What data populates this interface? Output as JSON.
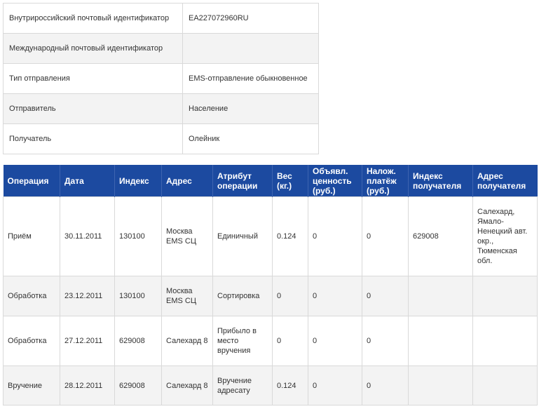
{
  "info": {
    "rows": [
      {
        "label": "Внутрироссийский почтовый идентификатор",
        "value": "EA227072960RU"
      },
      {
        "label": "Международный почтовый идентификатор",
        "value": ""
      },
      {
        "label": "Тип отправления",
        "value": "EMS-отправление обыкновенное"
      },
      {
        "label": "Отправитель",
        "value": "Население"
      },
      {
        "label": "Получатель",
        "value": "Олейник"
      }
    ]
  },
  "operations": {
    "headers": {
      "operation": "Операция",
      "date": "Дата",
      "index": "Индекс",
      "address": "Адрес",
      "attribute": "Атрибут операции",
      "weight": "Вес (кг.)",
      "declared_value": "Объявл. ценность (руб.)",
      "cod": "Налож. платёж (руб.)",
      "recipient_index": "Индекс получателя",
      "recipient_address": "Адрес получателя"
    },
    "rows": [
      {
        "operation": "Приём",
        "date": "30.11.2011",
        "index": "130100",
        "address": "Москва EMS СЦ",
        "attribute": "Единичный",
        "weight": "0.124",
        "declared_value": "0",
        "cod": "0",
        "recipient_index": "629008",
        "recipient_address": "Салехард, Ямало-Ненецкий авт. окр., Тюменская обл."
      },
      {
        "operation": "Обработка",
        "date": "23.12.2011",
        "index": "130100",
        "address": "Москва EMS СЦ",
        "attribute": "Сортировка",
        "weight": "0",
        "declared_value": "0",
        "cod": "0",
        "recipient_index": "",
        "recipient_address": ""
      },
      {
        "operation": "Обработка",
        "date": "27.12.2011",
        "index": "629008",
        "address": "Салехард 8",
        "attribute": "Прибыло в место вручения",
        "weight": "0",
        "declared_value": "0",
        "cod": "0",
        "recipient_index": "",
        "recipient_address": ""
      },
      {
        "operation": "Вручение",
        "date": "28.12.2011",
        "index": "629008",
        "address": "Салехард 8",
        "attribute": "Вручение адресату",
        "weight": "0.124",
        "declared_value": "0",
        "cod": "0",
        "recipient_index": "",
        "recipient_address": ""
      }
    ]
  }
}
